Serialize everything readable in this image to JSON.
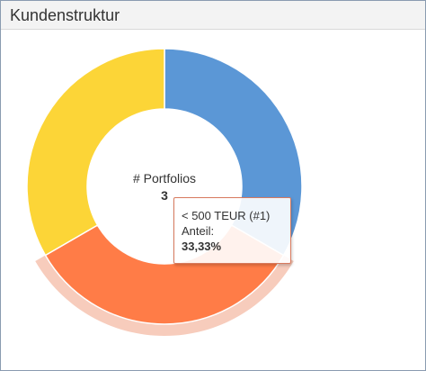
{
  "panel": {
    "title": "Kundenstruktur"
  },
  "chart_data": {
    "type": "pie",
    "variant": "donut",
    "center_label": "# Portfolios",
    "center_value": "3",
    "slices": [
      {
        "label": "< 500 TEUR (#1)",
        "value": 1,
        "color": "#5b97d6"
      },
      {
        "label": "",
        "value": 1,
        "color": "#ff7c47"
      },
      {
        "label": "",
        "value": 1,
        "color": "#fcd537"
      }
    ],
    "highlighted_slice": 1,
    "highlight_color": "#f7ccbc"
  },
  "tooltip": {
    "title": "< 500 TEUR (#1)",
    "metric_label": "Anteil:",
    "metric_value": "33,33%"
  }
}
